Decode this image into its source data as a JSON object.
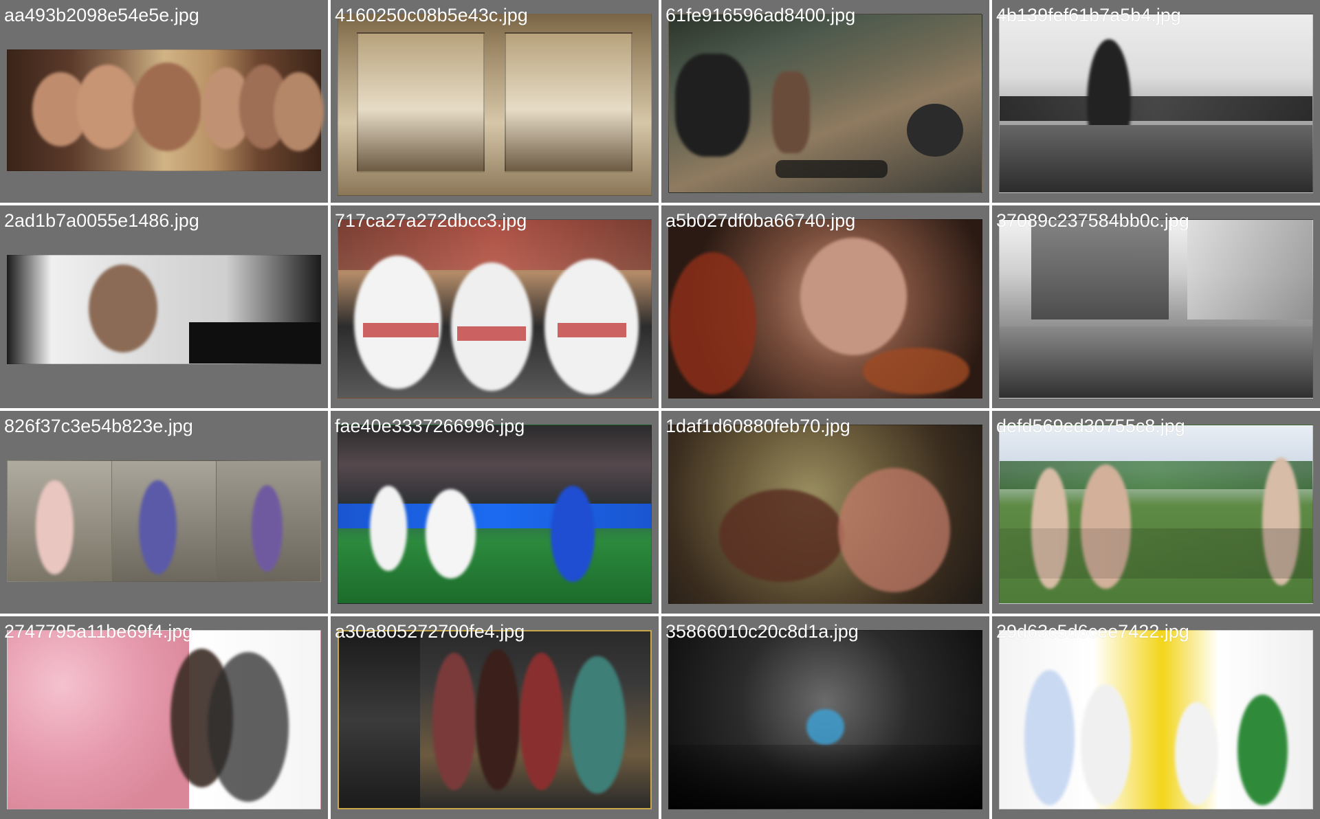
{
  "tiles": [
    {
      "name": "aa493b2098e54e5e.jpg"
    },
    {
      "name": "4160250c08b5e43c.jpg"
    },
    {
      "name": "61fe916596ad8400.jpg"
    },
    {
      "name": "4b139fef61b7a5b4.jpg"
    },
    {
      "name": "2ad1b7a0055e1486.jpg"
    },
    {
      "name": "717ca27a272dbcc3.jpg"
    },
    {
      "name": "a5b027df0ba66740.jpg"
    },
    {
      "name": "37089c237584bb0c.jpg"
    },
    {
      "name": "826f37c3e54b823e.jpg"
    },
    {
      "name": "fae40e3337266996.jpg"
    },
    {
      "name": "1daf1d60880feb70.jpg"
    },
    {
      "name": "defd569ed30755c8.jpg"
    },
    {
      "name": "2747795a11be69f4.jpg"
    },
    {
      "name": "a30a805272700fe4.jpg"
    },
    {
      "name": "35866010c20c8d1a.jpg"
    },
    {
      "name": "29d63c5d6cee7422.jpg"
    }
  ]
}
